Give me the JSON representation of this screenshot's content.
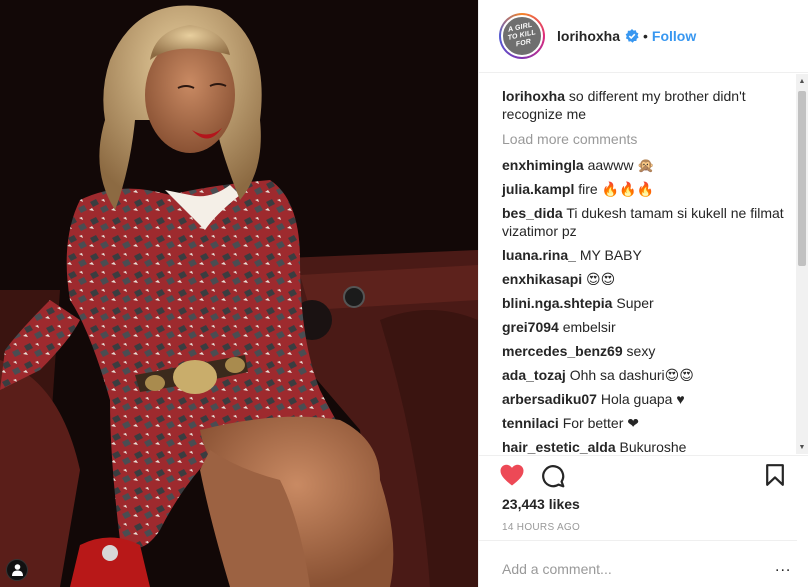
{
  "post": {
    "username": "lorihoxha",
    "follow_label": "Follow",
    "separator": "•",
    "avatar_text": "A GIRL TO KILL FOR",
    "caption": {
      "user": "lorihoxha",
      "text": "so different my brother didn't recognize me"
    },
    "load_more": "Load more comments",
    "comments": [
      {
        "user": "enxhimingla",
        "text": "aawww 🙊"
      },
      {
        "user": "julia.kampl",
        "text": "fire 🔥🔥🔥"
      },
      {
        "user": "bes_dida",
        "text": "Ti dukesh tamam si kukell ne filmat vizatimor pz"
      },
      {
        "user": "luana.rina_",
        "text": "MY BABY"
      },
      {
        "user": "enxhikasapi",
        "text": "😍😍"
      },
      {
        "user": "blini.nga.shtepia",
        "text": "Super"
      },
      {
        "user": "grei7094",
        "text": "embelsir"
      },
      {
        "user": "mercedes_benz69",
        "text": "sexy"
      },
      {
        "user": "ada_tozaj",
        "text": "Ohh sa dashuri😍😍"
      },
      {
        "user": "arbersadiku07",
        "text": "Hola guapa ♥"
      },
      {
        "user": "tennilaci",
        "text": "For better ❤"
      },
      {
        "user": "hair_estetic_alda",
        "text": "Bukuroshe"
      }
    ],
    "likes": "23,443 likes",
    "time": "14 HOURS AGO",
    "add_comment_placeholder": "Add a comment...",
    "more_options": "..."
  },
  "icons": {
    "like": "heart-filled-icon",
    "comment": "comment-bubble-icon",
    "save": "bookmark-icon",
    "verified": "verified-badge-icon",
    "tags": "user-tag-icon"
  },
  "colors": {
    "accent": "#3897f0",
    "heart": "#ed4956",
    "verified": "#3897f0",
    "muted": "#999999"
  }
}
